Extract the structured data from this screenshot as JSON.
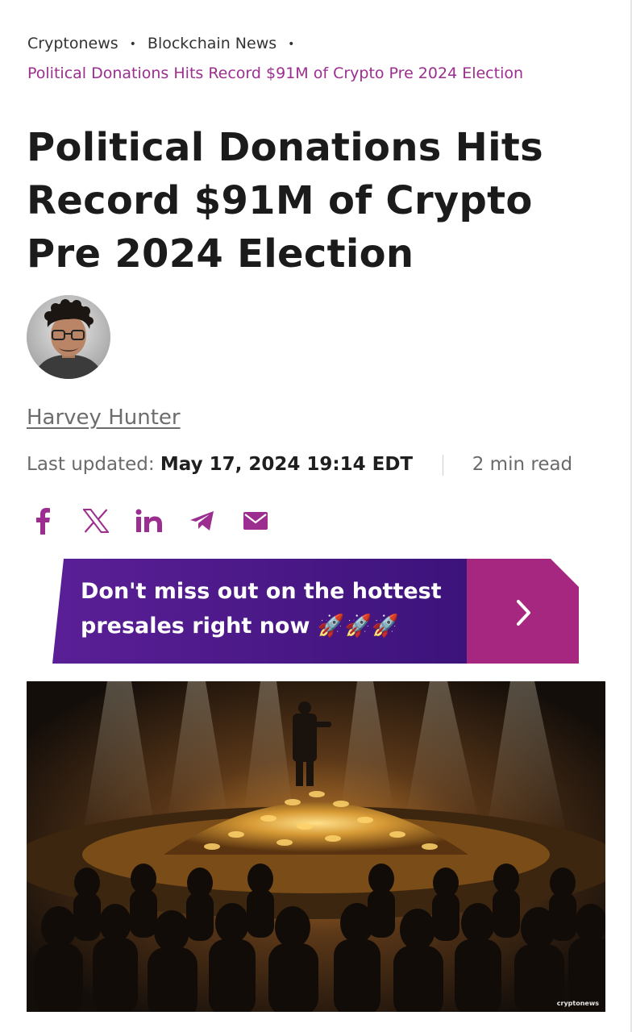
{
  "breadcrumb": {
    "items": [
      "Cryptonews",
      "Blockchain News"
    ],
    "current": "Political Donations Hits Record $91M of Crypto Pre 2024 Election"
  },
  "article": {
    "title": "Political Donations Hits Record $91M of Crypto Pre 2024 Election",
    "author": "Harvey Hunter",
    "last_updated_label": "Last updated:",
    "last_updated_value": "May 17, 2024 19:14 EDT",
    "read_time": "2 min read"
  },
  "share": {
    "icons": [
      "facebook-icon",
      "x-icon",
      "linkedin-icon",
      "telegram-icon",
      "email-icon"
    ]
  },
  "banner": {
    "line1": "Don't miss out on the hottest",
    "line2": "presales right now 🚀🚀🚀",
    "colors": {
      "left": "#4b1a8c",
      "right": "#a6277f"
    }
  },
  "hero": {
    "watermark": "cryptonews"
  },
  "colors": {
    "accent": "#9b2e8e",
    "text": "#1b1b1b",
    "muted": "#6a6a6a"
  }
}
